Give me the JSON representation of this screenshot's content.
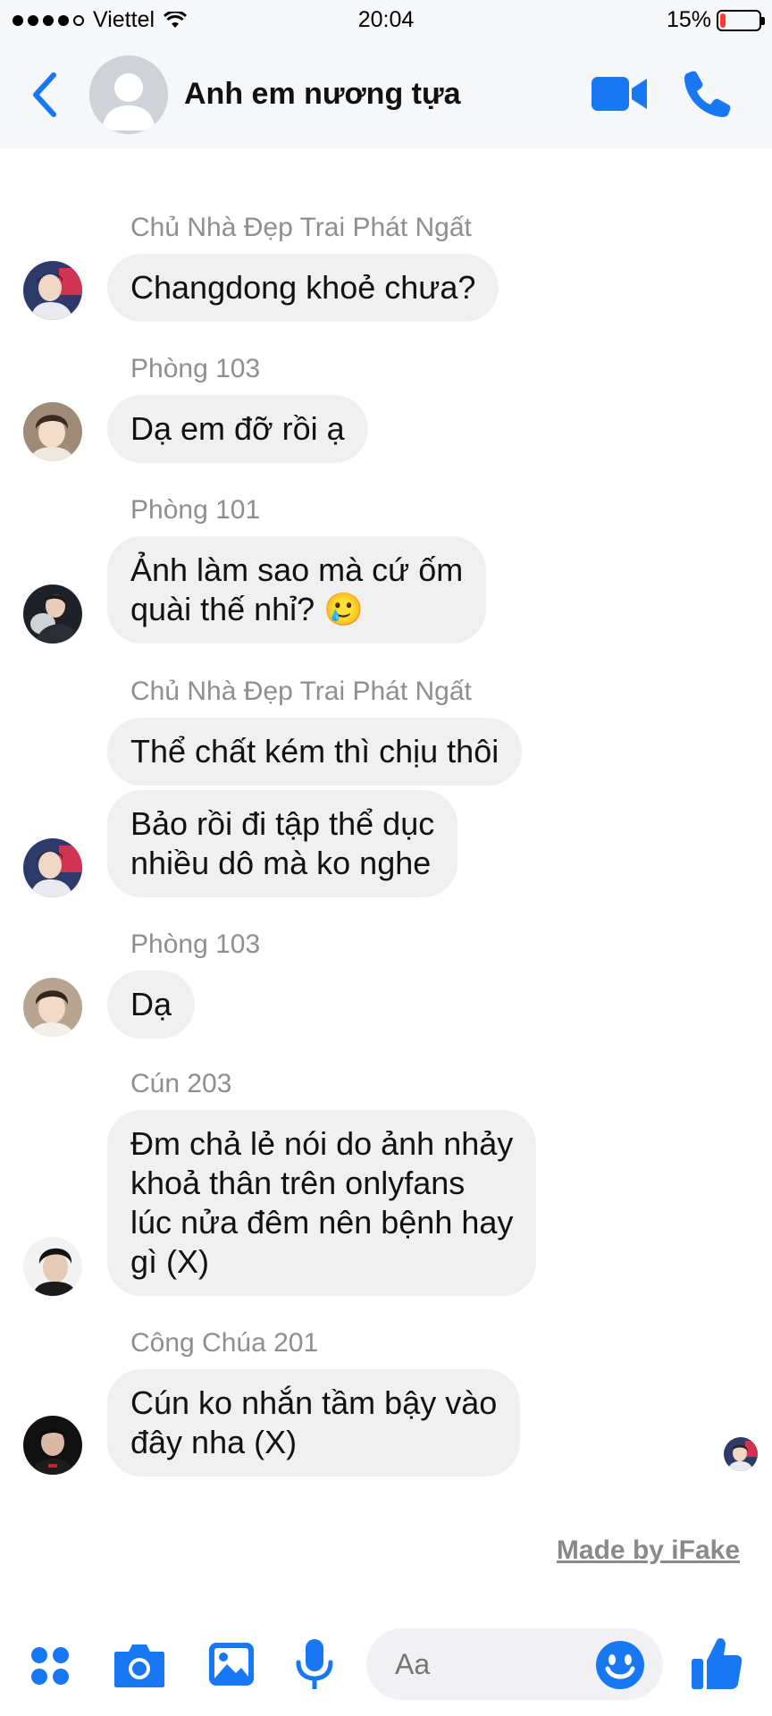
{
  "status_bar": {
    "carrier": "Viettel",
    "time": "20:04",
    "battery_percent": "15%",
    "battery_level": 0.15,
    "signal_dots_filled": 4,
    "signal_dots_total": 5
  },
  "header": {
    "title": "Anh em nương tựa",
    "back_icon": "chevron-left-icon",
    "video_icon": "video-camera-icon",
    "call_icon": "phone-icon"
  },
  "messages": [
    {
      "sender": "Chủ Nhà Đẹp Trai Phát Ngất",
      "lines": [
        "Changdong khoẻ chưa?"
      ]
    },
    {
      "sender": "Phòng 103",
      "lines": [
        "Dạ em đỡ rồi ạ"
      ]
    },
    {
      "sender": "Phòng 101",
      "lines": [
        "Ảnh làm sao mà cứ ốm",
        "quài thế nhỉ? 🥲"
      ]
    },
    {
      "sender": "Chủ Nhà Đẹp Trai Phát Ngất",
      "lines": [
        "Thể chất kém thì chịu thôi"
      ]
    },
    {
      "sender": "",
      "lines": [
        "Bảo rồi đi tập thể dục",
        "nhiều dô mà ko nghe"
      ]
    },
    {
      "sender": "Phòng 103",
      "lines": [
        "Dạ"
      ]
    },
    {
      "sender": "Cún 203",
      "lines": [
        "Đm chả lẻ nói do ảnh nhảy",
        "khoả thân trên onlyfans",
        "lúc nửa đêm nên bệnh hay",
        "gì (X)"
      ]
    },
    {
      "sender": "Công Chúa 201",
      "lines": [
        "Cún ko nhắn tầm bậy vào",
        "đây nha (X)"
      ]
    }
  ],
  "watermark": "Made by iFake",
  "composer": {
    "placeholder": "Aa"
  },
  "colors": {
    "accent": "#1877f2",
    "bubble": "#f0f0f0",
    "sender_text": "#8e8e93",
    "header_bg": "#f6f7f9"
  }
}
